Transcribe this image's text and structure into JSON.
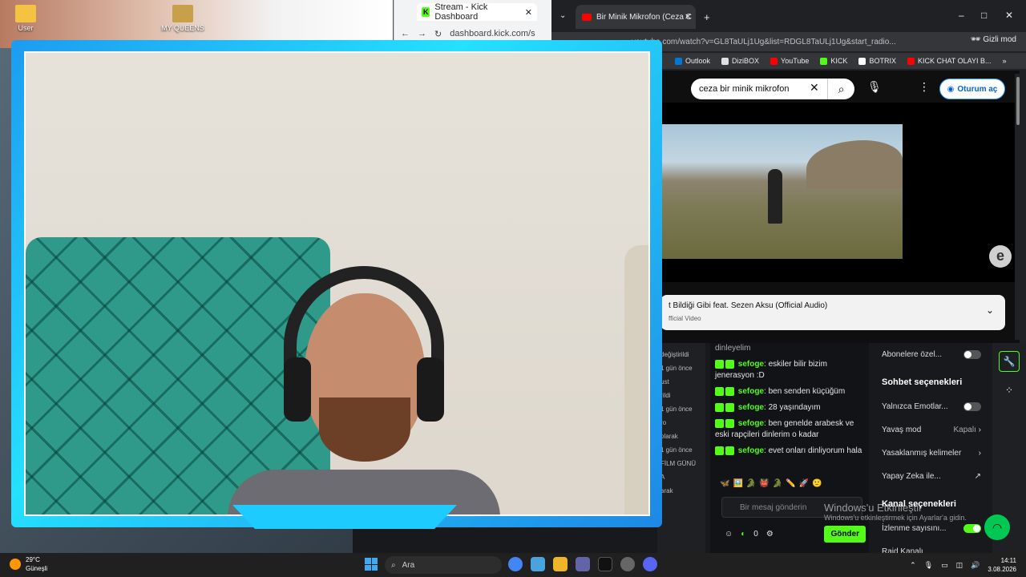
{
  "desktop": {
    "icons": [
      {
        "label": "User"
      },
      {
        "label": "MY QUEENS"
      }
    ]
  },
  "kick_window": {
    "tab_title": "Stream - Kick Dashboard",
    "url": "dashboard.kick.com/s"
  },
  "youtube_window": {
    "tab_title": "Bir Minik Mikrofon (Ceza C",
    "url": "youtube.com/watch?v=GL8TaULj1Ug&list=RDGL8TaULj1Ug&start_radio...",
    "incognito_label": "Gizli mod",
    "bookmarks": [
      {
        "label": "Outlook",
        "color": "#0078d4"
      },
      {
        "label": "DiziBOX",
        "color": "#e0e0e0"
      },
      {
        "label": "YouTube",
        "color": "#ff0000"
      },
      {
        "label": "KICK",
        "color": "#53fc18"
      },
      {
        "label": "BOTRIX",
        "color": "#ffffff"
      },
      {
        "label": "KICK CHAT OLAYI B...",
        "color": "#ff0000"
      }
    ],
    "search_value": "ceza bir minik mikrofon",
    "signin_label": "Oturum aç",
    "info_title": "t Bildiği Gibi feat. Sezen Aksu (Official Audio)",
    "info_subtitle": "fficial Video",
    "channel_mark": "e"
  },
  "activity": {
    "items": [
      "değiştirildi",
      "1 gün önce",
      "ust",
      "rildi",
      "1 gün önce",
      "ro",
      "olarak",
      "1 gün önce",
      "FİLM GÜNÜ",
      "A",
      "arak"
    ]
  },
  "chat": {
    "top_text": "dinleyelim",
    "messages": [
      {
        "user": "sefoge",
        "text": "eskiler bilir bizim jenerasyon :D"
      },
      {
        "user": "sefoge",
        "text": "ben senden küçüğüm"
      },
      {
        "user": "sefoge",
        "text": "28 yaşındayım"
      },
      {
        "user": "sefoge",
        "text": "ben genelde arabesk ve eski rapçileri dinlerim o kadar"
      },
      {
        "user": "sefoge",
        "text": "evet onları dinliyorum hala"
      }
    ],
    "emotes": "🦋🖼️🐊👹🐊✏️🚀🙂",
    "input_placeholder": "Bir mesaj gönderin",
    "points": "0",
    "send_label": "Gönder"
  },
  "settings": {
    "subscribers_only": "Abonelere özel...",
    "chat_options_title": "Sohbet seçenekleri",
    "emotes_only": "Yalnızca Emotlar...",
    "slow_mode": "Yavaş mod",
    "slow_mode_value": "Kapalı",
    "banned_words": "Yasaklanmış kelimeler",
    "ai": "Yapay Zeka ile...",
    "channel_options_title": "Kanal seçenekleri",
    "viewer_count": "İzlenme sayısını...",
    "raid": "Raid Kanalı"
  },
  "watermark": {
    "line1": "Windows'u Etkinleştir",
    "line2": "Windows'u etkinleştirmek için Ayarlar'a gidin."
  },
  "taskbar": {
    "temperature": "29°C",
    "weather": "Güneşli",
    "search_placeholder": "Ara",
    "time": "14:11",
    "date": "3.08.2026"
  }
}
